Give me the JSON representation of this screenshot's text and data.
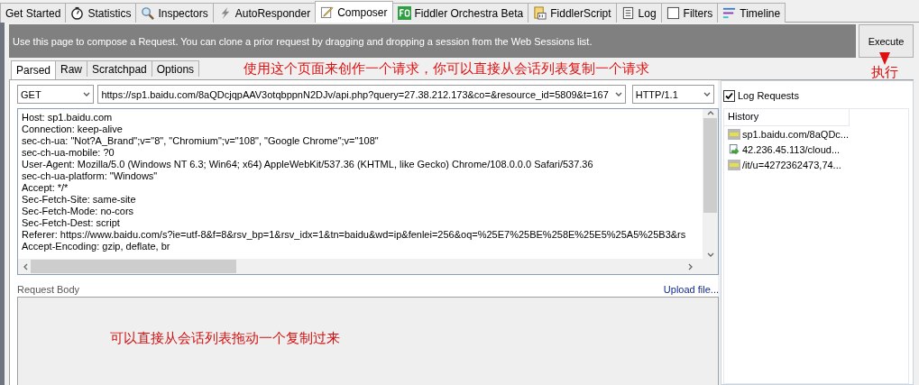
{
  "tabs": [
    {
      "label": "Get Started",
      "kind": "plain",
      "selected": false
    },
    {
      "label": "Statistics",
      "kind": "stopwatch",
      "selected": false
    },
    {
      "label": "Inspectors",
      "kind": "magnifier",
      "selected": false
    },
    {
      "label": "AutoResponder",
      "kind": "lightning",
      "selected": false
    },
    {
      "label": "Composer",
      "kind": "pencil",
      "selected": true
    },
    {
      "label": "Fiddler Orchestra Beta",
      "kind": "fo",
      "selected": false
    },
    {
      "label": "FiddlerScript",
      "kind": "script",
      "selected": false
    },
    {
      "label": "Log",
      "kind": "log",
      "selected": false
    },
    {
      "label": "Filters",
      "kind": "checkbox",
      "selected": false
    },
    {
      "label": "Timeline",
      "kind": "timeline",
      "selected": false
    }
  ],
  "banner": "Use this page to compose a Request. You can clone a prior request by dragging and dropping a session from the Web Sessions list.",
  "execute_button": "Execute",
  "annotations": {
    "top": "使用这个页面来创作一个请求，你可以直接从会话列表复制一个请求",
    "execute": "执行",
    "body": "可以直接从会话列表拖动一个复制过来"
  },
  "composer_tabs": [
    {
      "label": "Parsed",
      "selected": true
    },
    {
      "label": "Raw",
      "selected": false
    },
    {
      "label": "Scratchpad",
      "selected": false
    },
    {
      "label": "Options",
      "selected": false
    }
  ],
  "request": {
    "method": "GET",
    "url": "https://sp1.baidu.com/8aQDcjqpAAV3otqbppnN2DJv/api.php?query=27.38.212.173&co=&resource_id=5809&t=167",
    "version": "HTTP/1.1",
    "headers": [
      "Host: sp1.baidu.com",
      "Connection: keep-alive",
      "sec-ch-ua: \"Not?A_Brand\";v=\"8\", \"Chromium\";v=\"108\", \"Google Chrome\";v=\"108\"",
      "sec-ch-ua-mobile: ?0",
      "User-Agent: Mozilla/5.0 (Windows NT 6.3; Win64; x64) AppleWebKit/537.36 (KHTML, like Gecko) Chrome/108.0.0.0 Safari/537.36",
      "sec-ch-ua-platform: \"Windows\"",
      "Accept: */*",
      "Sec-Fetch-Site: same-site",
      "Sec-Fetch-Mode: no-cors",
      "Sec-Fetch-Dest: script",
      "Referer: https://www.baidu.com/s?ie=utf-8&f=8&rsv_bp=1&rsv_idx=1&tn=baidu&wd=ip&fenlei=256&oq=%25E7%25BE%258E%25E5%25A5%25B3&rs",
      "Accept-Encoding: gzip, deflate, br"
    ],
    "body_label": "Request Body",
    "upload_link": "Upload file..."
  },
  "log_requests": {
    "label": "Log Requests",
    "checked": true
  },
  "history": {
    "title": "History",
    "items": [
      {
        "label": "sp1.baidu.com/8aQDc...",
        "kind": "get"
      },
      {
        "label": "42.236.45.113/cloud...",
        "kind": "redirect"
      },
      {
        "label": "/it/u=4272362473,74...",
        "kind": "get"
      }
    ]
  }
}
